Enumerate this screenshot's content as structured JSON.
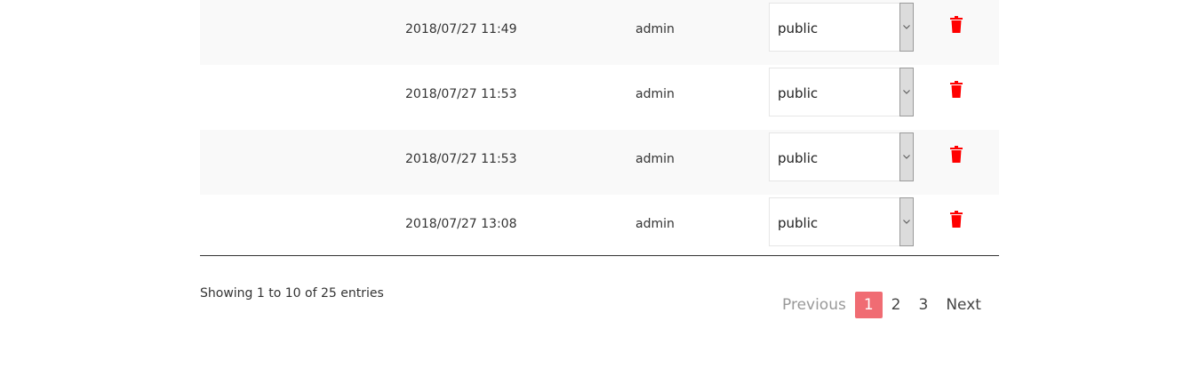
{
  "rows": [
    {
      "date": "2018/07/27 11:49",
      "user": "admin",
      "visibility": "public"
    },
    {
      "date": "2018/07/27 11:53",
      "user": "admin",
      "visibility": "public"
    },
    {
      "date": "2018/07/27 11:53",
      "user": "admin",
      "visibility": "public"
    },
    {
      "date": "2018/07/27 13:08",
      "user": "admin",
      "visibility": "public"
    }
  ],
  "footer": {
    "info": "Showing 1 to 10 of 25 entries"
  },
  "pagination": {
    "previous": "Previous",
    "pages": [
      "1",
      "2",
      "3"
    ],
    "active_page": "1",
    "next": "Next"
  },
  "colors": {
    "delete_icon": "#ff0000",
    "active_page_bg": "#f06c73"
  },
  "icons": {
    "delete": "trash-icon",
    "select_arrow": "chevron-down-icon"
  }
}
